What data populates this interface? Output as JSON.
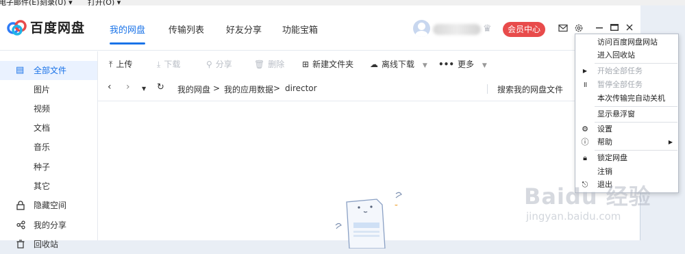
{
  "background_menubar": [
    "电子邮件(E)",
    "刻录(U) ▾",
    "打开(O) ▾"
  ],
  "app": {
    "logo_text": "百度网盘",
    "nav_tabs": [
      "我的网盘",
      "传输列表",
      "好友分享",
      "功能宝箱"
    ],
    "vip_button": "会员中心",
    "colors": {
      "accent": "#1a73e8",
      "vip": "#e84b4b"
    }
  },
  "sidebar": {
    "items": [
      {
        "label": "全部文件",
        "icon": "document-icon"
      },
      {
        "label": "图片"
      },
      {
        "label": "视频"
      },
      {
        "label": "文档"
      },
      {
        "label": "音乐"
      },
      {
        "label": "种子"
      },
      {
        "label": "其它"
      },
      {
        "label": "隐藏空间",
        "icon": "lock-icon"
      },
      {
        "label": "我的分享",
        "icon": "share-icon"
      },
      {
        "label": "回收站",
        "icon": "trash-icon"
      }
    ]
  },
  "toolbar": {
    "upload": "上传",
    "download": "下载",
    "share": "分享",
    "delete": "删除",
    "new_folder": "新建文件夹",
    "offline_download": "离线下载",
    "more": "更多"
  },
  "pathbar": {
    "crumbs": [
      "我的网盘",
      "我的应用数据",
      "director"
    ],
    "search_placeholder": "搜索我的网盘文件"
  },
  "menu": {
    "items": [
      {
        "label": "访问百度网盘网站"
      },
      {
        "label": "进入回收站"
      },
      {
        "label": "开始全部任务"
      },
      {
        "label": "暂停全部任务"
      },
      {
        "label": "本次传输完自动关机"
      },
      {
        "label": "显示悬浮窗"
      },
      {
        "label": "设置"
      },
      {
        "label": "帮助"
      },
      {
        "label": "锁定网盘"
      },
      {
        "label": "注销"
      },
      {
        "label": "退出"
      }
    ]
  },
  "watermark": {
    "brand": "Baidu 经验",
    "url": "jingyan.baidu.com"
  }
}
